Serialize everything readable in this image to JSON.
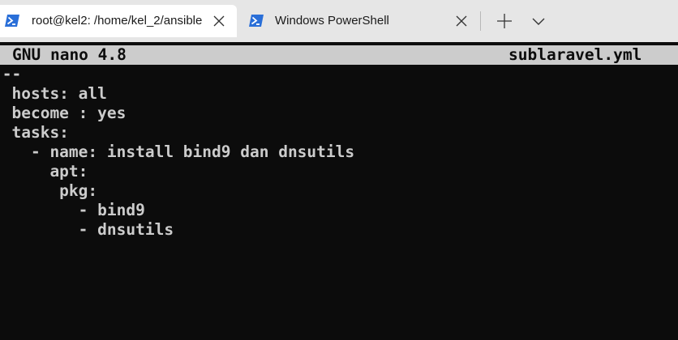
{
  "tabs": [
    {
      "title": "root@kel2: /home/kel_2/ansible",
      "icon": "powershell-icon",
      "active": true
    },
    {
      "title": "Windows PowerShell",
      "icon": "powershell-icon",
      "active": false
    }
  ],
  "tab_controls": {
    "new_tab_icon": "plus-icon",
    "dropdown_icon": "chevron-down-icon",
    "close_icon": "close-icon"
  },
  "nano": {
    "version": "GNU nano 4.8",
    "filename": "sublaravel.yml"
  },
  "file_lines": [
    "---",
    "- hosts: all",
    "  become : yes",
    "  tasks:",
    "    - name: install bind9 dan dnsutils",
    "      apt:",
    "       pkg:",
    "         - bind9",
    "         - dnsutils"
  ],
  "colors": {
    "terminal_background": "#0c0c0c",
    "terminal_text": "#cccccc",
    "titlebar_background": "#e6e6e6",
    "active_tab_background": "#ffffff",
    "powershell_blue": "#2a6fd8"
  }
}
